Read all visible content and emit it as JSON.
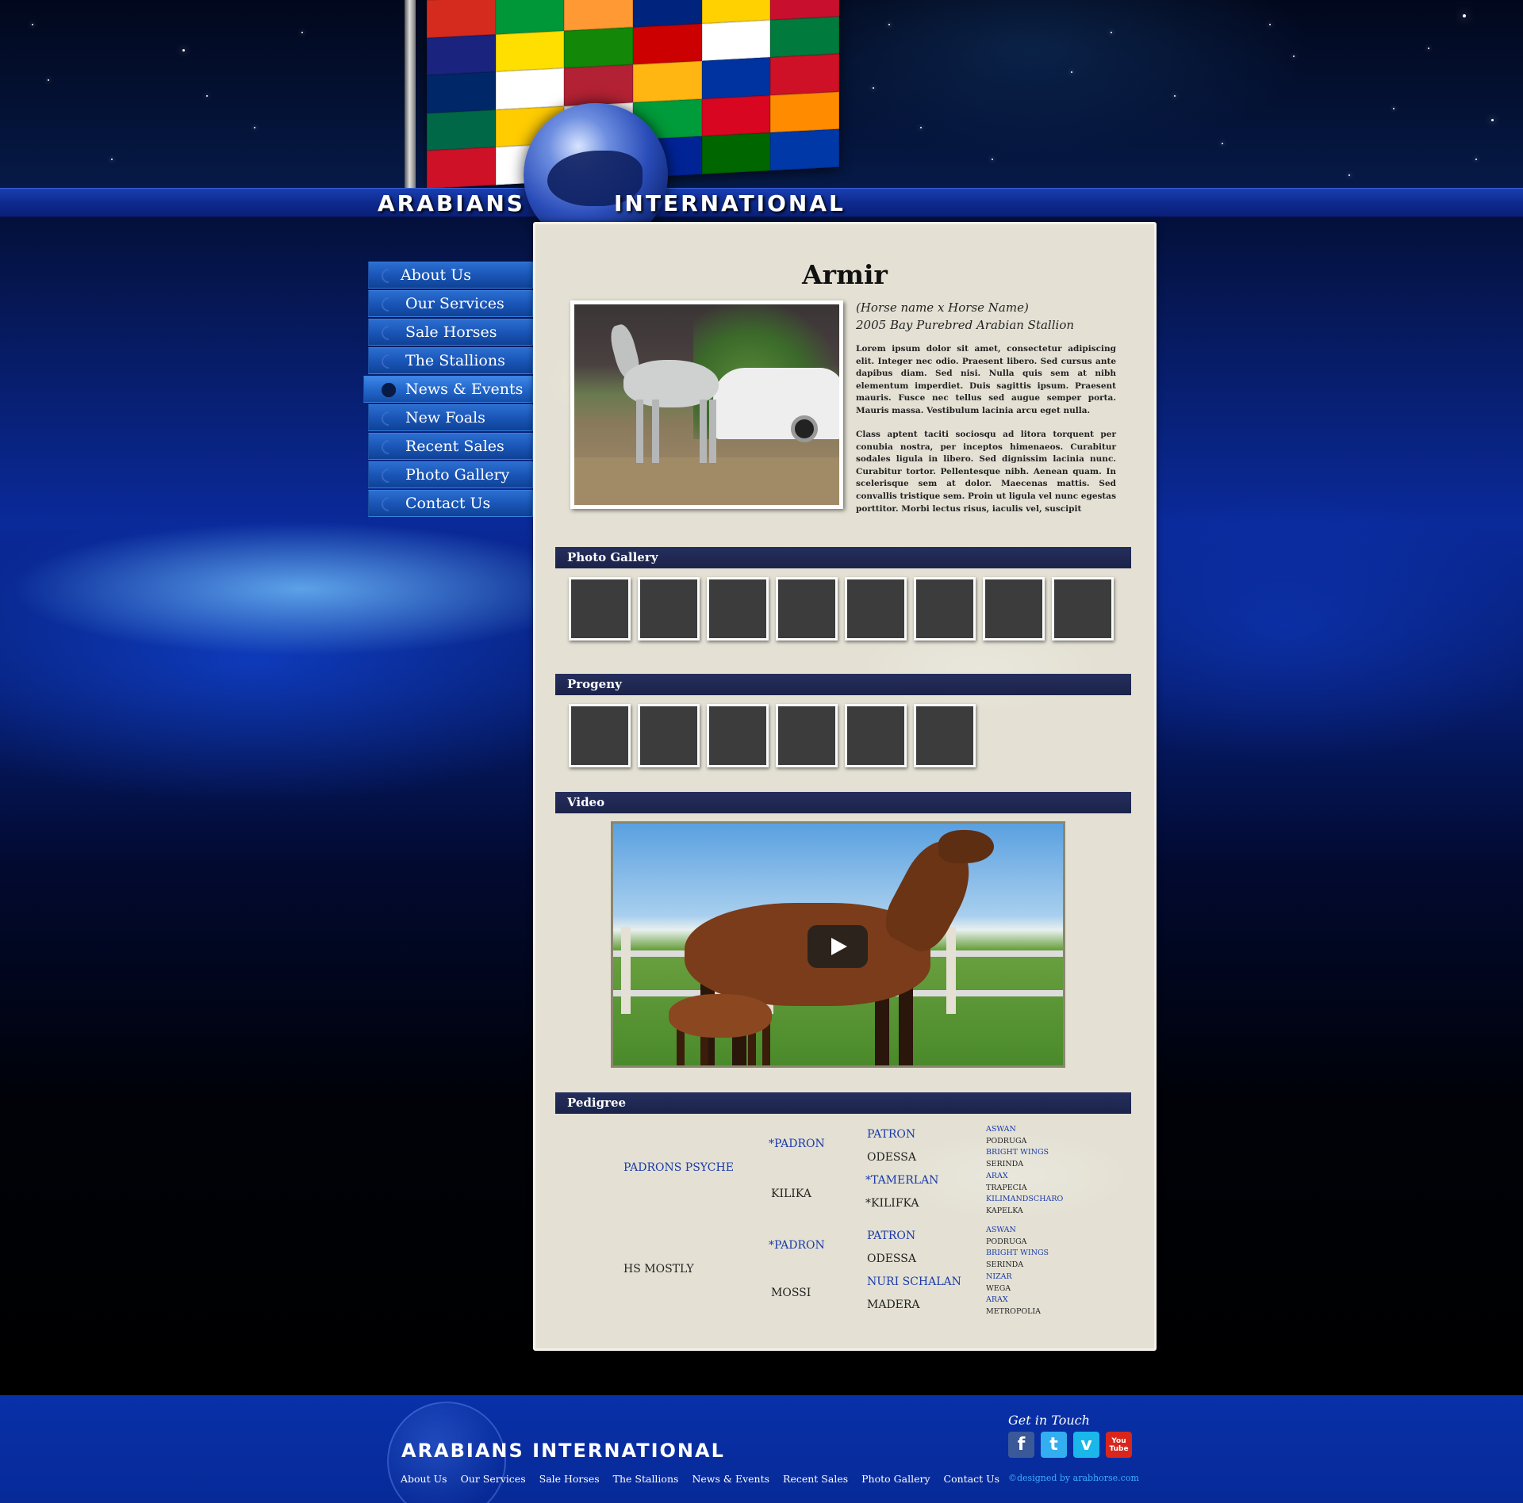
{
  "brand": {
    "left_word": "ARABIANS",
    "right_word": "INTERNATIONAL"
  },
  "nav": {
    "items": [
      {
        "label": "About Us"
      },
      {
        "label": "Our Services"
      },
      {
        "label": "Sale Horses"
      },
      {
        "label": "The Stallions"
      },
      {
        "label": "News & Events",
        "active": true
      },
      {
        "label": "New Foals"
      },
      {
        "label": "Recent Sales"
      },
      {
        "label": "Photo Gallery"
      },
      {
        "label": "Contact Us"
      }
    ]
  },
  "horse": {
    "name": "Armir",
    "parentage": "(Horse name x Horse Name)",
    "description": "2005 Bay Purebred Arabian Stallion",
    "paragraph1": "Lorem ipsum dolor sit amet, consectetur adipiscing elit. Integer nec odio. Praesent libero. Sed cursus ante dapibus diam. Sed nisi. Nulla quis sem at nibh elementum imperdiet. Duis sagittis ipsum. Praesent mauris. Fusce nec tellus sed augue semper porta. Mauris massa. Vestibulum lacinia arcu eget nulla.",
    "paragraph2": "Class aptent taciti sociosqu ad litora torquent per conubia nostra, per inceptos himenaeos. Curabitur sodales ligula in libero. Sed dignissim lacinia nunc. Curabitur tortor. Pellentesque nibh. Aenean quam. In scelerisque sem at dolor. Maecenas mattis. Sed convallis tristique sem. Proin ut ligula vel nunc egestas porttitor. Morbi lectus risus, iaculis vel, suscipit"
  },
  "sections": {
    "gallery": "Photo Gallery",
    "progeny": "Progeny",
    "video": "Video",
    "pedigree": "Pedigree"
  },
  "gallery_count": 8,
  "progeny_count": 6,
  "pedigree": {
    "sire": "PADRONS PSYCHE",
    "dam": "HS MOSTLY",
    "sire_sire": "*PADRON",
    "sire_dam": "KILIKA",
    "dam_sire": "*PADRON",
    "dam_dam": "MOSSI",
    "g3": [
      "PATRON",
      "ODESSA",
      "*TAMERLAN",
      "*KILIFKA",
      "PATRON",
      "ODESSA",
      "NURI SCHALAN",
      "MADERA"
    ],
    "g4": [
      "ASWAN",
      "PODRUGA",
      "BRIGHT WINGS",
      "SERINDA",
      "ARAX",
      "TRAPECIA",
      "KILIMANDSCHARO",
      "KAPELKA",
      "ASWAN",
      "PODRUGA",
      "BRIGHT WINGS",
      "SERINDA",
      "NIZAR",
      "WEGA",
      "ARAX",
      "METROPOLIA"
    ]
  },
  "footer": {
    "brand": "ARABIANS INTERNATIONAL",
    "nav": [
      "About Us",
      "Our Services",
      "Sale Horses",
      "The Stallions",
      "News & Events",
      "Recent Sales",
      "Photo Gallery",
      "Contact Us"
    ],
    "get_in_touch": "Get in Touch",
    "credit": "©designed by arabhorse.com",
    "social": [
      {
        "name": "facebook-icon",
        "glyph": "f",
        "color": "#3b5998"
      },
      {
        "name": "twitter-icon",
        "glyph": "t",
        "color": "#33aef0"
      },
      {
        "name": "vimeo-icon",
        "glyph": "v",
        "color": "#1ab7ea"
      },
      {
        "name": "youtube-icon",
        "glyph": "You Tube",
        "color": "#d8261d"
      }
    ]
  },
  "colors": {
    "header_band": "#0d2a8f",
    "nav_button": "#1a56b8",
    "section_bar": "#1b234a",
    "pedigree_blue": "#1a3aa8",
    "footer": "#072a98",
    "panel": "#e4e1d4"
  }
}
